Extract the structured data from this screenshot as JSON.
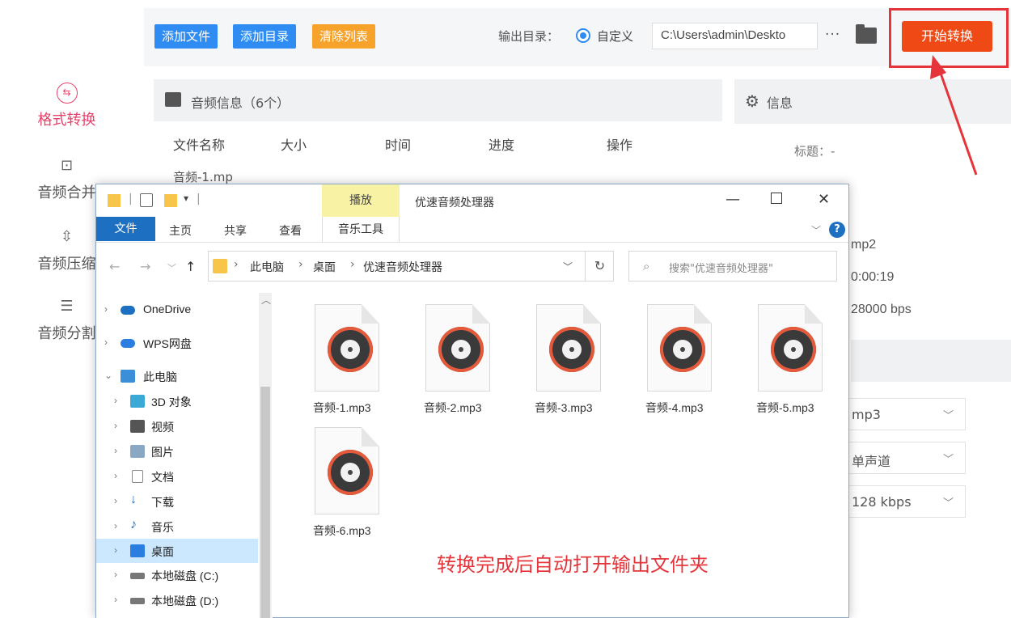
{
  "app": {
    "nav": [
      "格式转换",
      "音频合并",
      "音频压缩",
      "音频分割"
    ],
    "nav_visible": [
      "格式转换",
      "音频合并",
      "音频压缩",
      "音频分割"
    ],
    "toolbar": {
      "add_file": "添加文件",
      "add_dir": "添加目录",
      "clear_list": "清除列表"
    },
    "output_label": "输出目录：",
    "output_option": "自定义",
    "output_path": "C:\\Users\\admin\\Deskto",
    "more": "···",
    "start_btn": "开始转换",
    "audio_info_title": "音频信息（6个）",
    "columns": [
      "文件名称",
      "大小",
      "时间",
      "进度",
      "操作"
    ],
    "row1_name": "音频-1.mp",
    "info_title": "信息",
    "info_title_label": "标题：-",
    "side_values": [
      "mp2",
      "0:00:19",
      "28000 bps"
    ],
    "selects": [
      "mp3",
      "单声道",
      "128 kbps"
    ],
    "colors": {
      "add_btn": "#2f8cf3",
      "clear_btn": "#f7a22b",
      "start": "#ef4a16",
      "accent": "#e8416b"
    }
  },
  "explorer": {
    "play_tab": "播放",
    "title": "优速音频处理器",
    "ribbon_tabs": [
      "文件",
      "主页",
      "共享",
      "查看"
    ],
    "music_tools": "音乐工具",
    "breadcrumb": [
      "此电脑",
      "桌面",
      "优速音频处理器"
    ],
    "search_placeholder": "搜索\"优速音频处理器\"",
    "tree": [
      "OneDrive",
      "WPS网盘",
      "此电脑",
      "3D 对象",
      "视频",
      "图片",
      "文档",
      "下载",
      "音乐",
      "桌面",
      "本地磁盘 (C:)",
      "本地磁盘 (D:)"
    ],
    "files": [
      "音频-1.mp3",
      "音频-2.mp3",
      "音频-3.mp3",
      "音频-4.mp3",
      "音频-5.mp3",
      "音频-6.mp3"
    ],
    "selected_tree": "桌面"
  },
  "annotation": "转换完成后自动打开输出文件夹"
}
